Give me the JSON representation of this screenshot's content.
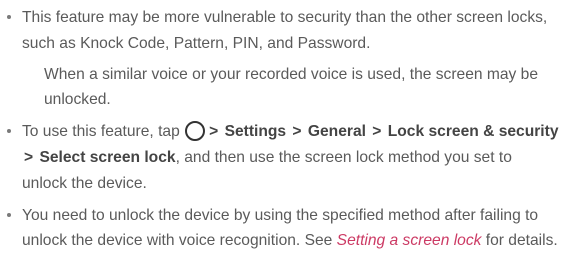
{
  "bullets": {
    "b1": {
      "line": "This feature may be more vulnerable to security than the other screen locks, such as Knock Code, Pattern, PIN, and Password.",
      "note": "When a similar voice or your recorded voice is used, the screen may be unlocked."
    },
    "b2": {
      "pre": "To use this feature, tap",
      "icon": "home-icon",
      "sep": ">",
      "settings": "Settings",
      "general": "General",
      "lock": "Lock screen & security",
      "select": "Select screen lock",
      "post": ", and then use the screen lock method you set to unlock the device."
    },
    "b3": {
      "pre": "You need to unlock the device by using the specified method after failing to unlock the device with voice recognition. See",
      "link": "Setting a screen lock",
      "post": "for details."
    }
  },
  "colors": {
    "text": "#5a5a5a",
    "bold": "#444444",
    "link": "#cc3a64"
  }
}
